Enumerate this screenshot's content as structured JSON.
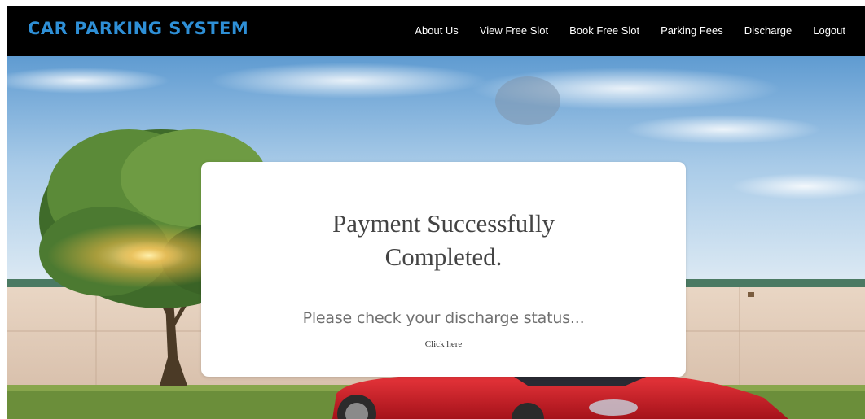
{
  "navbar": {
    "brand": "CAR PARKING SYSTEM",
    "links": [
      {
        "label": "About Us"
      },
      {
        "label": "View Free Slot"
      },
      {
        "label": "Book Free Slot"
      },
      {
        "label": "Parking Fees"
      },
      {
        "label": "Discharge"
      },
      {
        "label": "Logout"
      }
    ]
  },
  "message": {
    "title_line1": "Payment Successfully",
    "title_line2": "Completed.",
    "subtitle": "Please check your discharge status...",
    "link_label": "Click here"
  },
  "colors": {
    "brand": "#2e8fd6",
    "navbar_bg": "#000000",
    "car": "#d8232a"
  }
}
